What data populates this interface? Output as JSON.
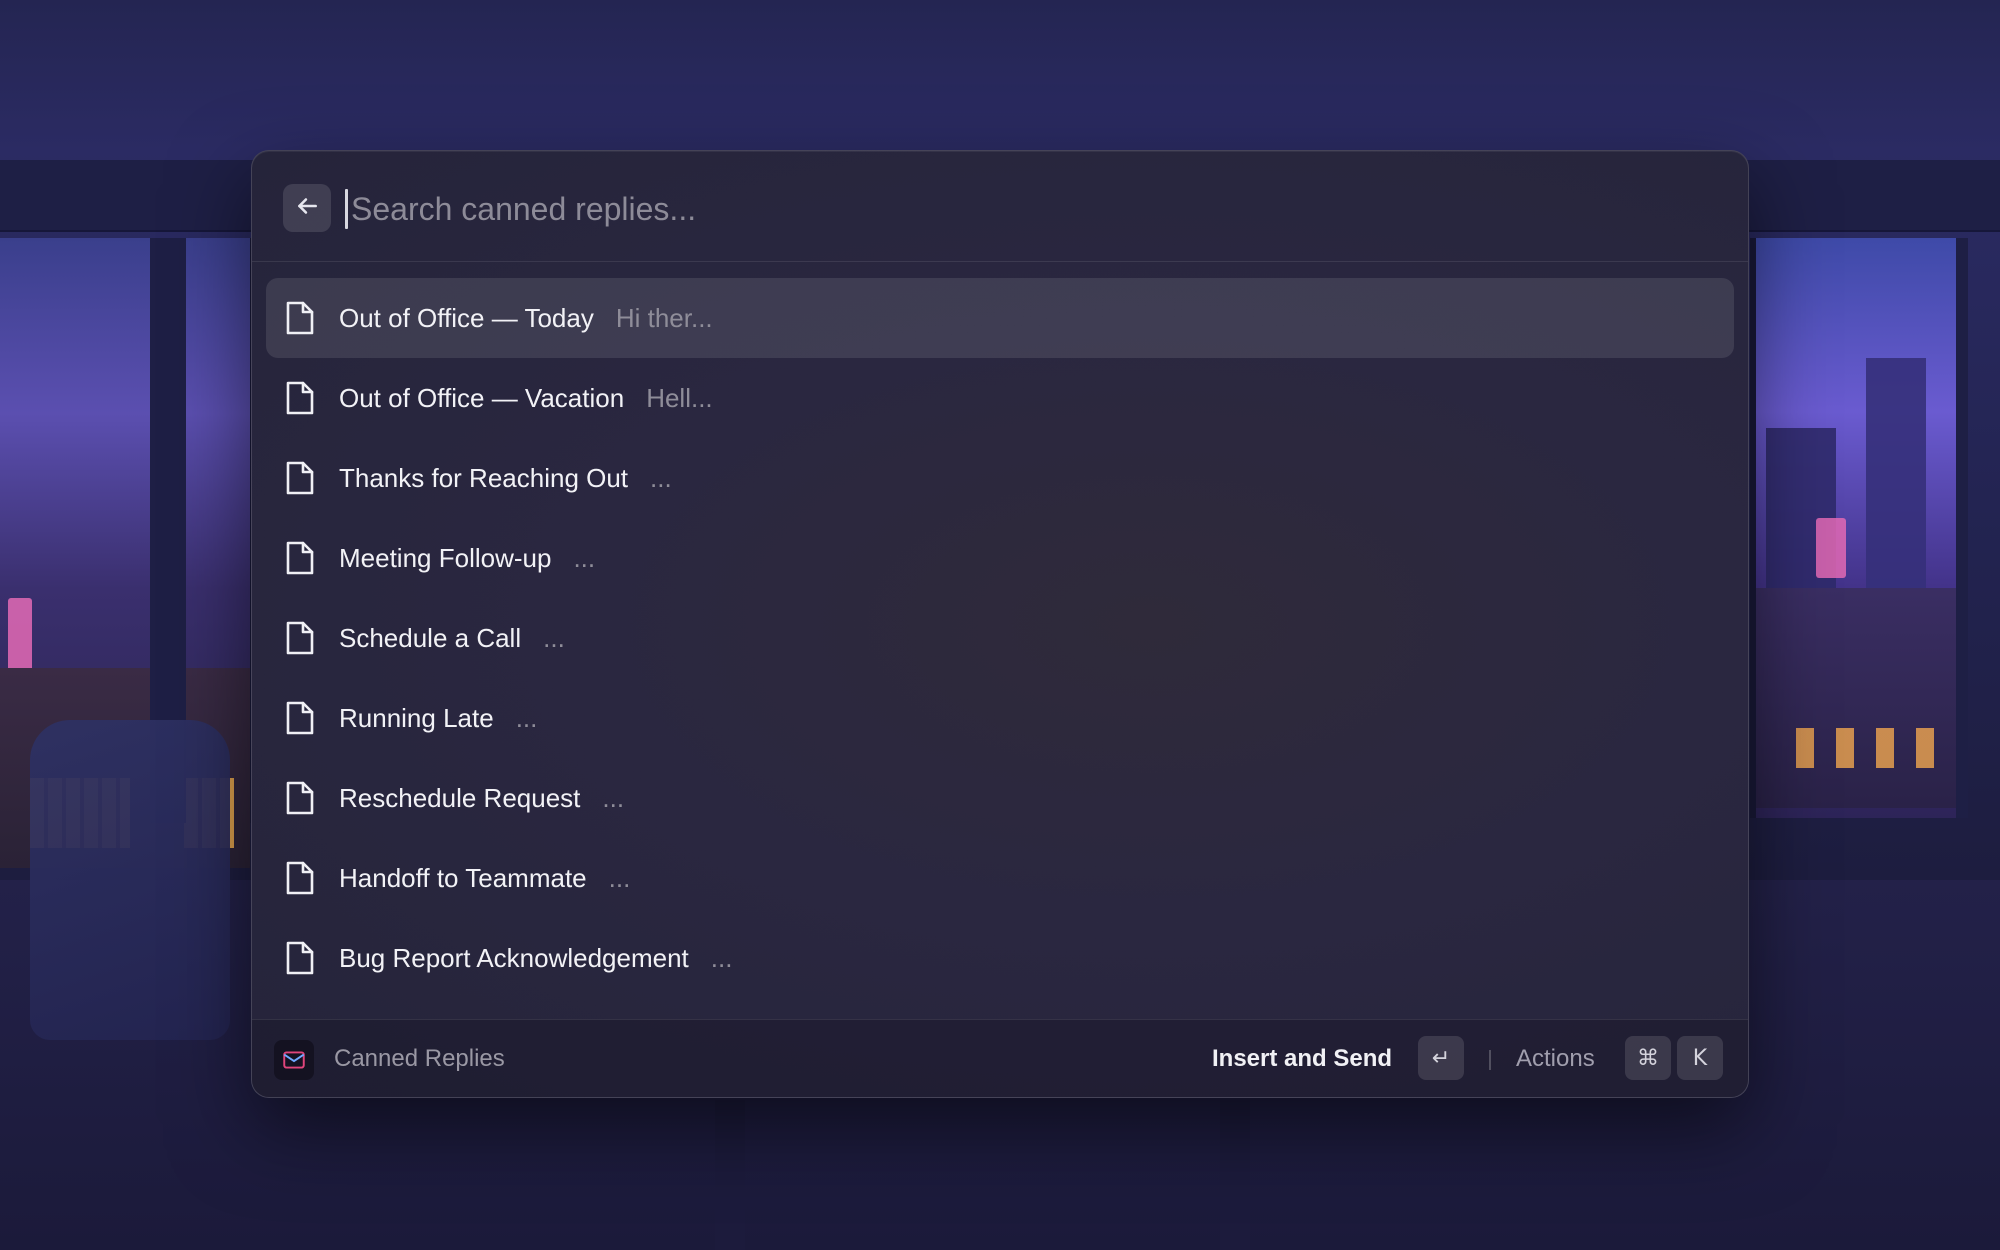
{
  "search": {
    "placeholder": "Search canned replies...",
    "value": ""
  },
  "items": [
    {
      "title": "Out of Office — Today",
      "subtitle": "Hi ther...",
      "selected": true
    },
    {
      "title": "Out of Office — Vacation",
      "subtitle": "Hell...",
      "selected": false
    },
    {
      "title": "Thanks for Reaching Out",
      "subtitle": "...",
      "selected": false
    },
    {
      "title": "Meeting Follow-up",
      "subtitle": "...",
      "selected": false
    },
    {
      "title": "Schedule a Call",
      "subtitle": "...",
      "selected": false
    },
    {
      "title": "Running Late",
      "subtitle": "...",
      "selected": false
    },
    {
      "title": "Reschedule Request",
      "subtitle": "...",
      "selected": false
    },
    {
      "title": "Handoff to Teammate",
      "subtitle": "...",
      "selected": false
    },
    {
      "title": "Bug Report Acknowledgement",
      "subtitle": "...",
      "selected": false
    }
  ],
  "footer": {
    "extension_name": "Canned Replies",
    "extension_icon": "mail-icon",
    "primary_action": "Insert and Send",
    "primary_shortcut": "↵",
    "actions_label": "Actions",
    "actions_shortcut": [
      "⌘",
      "K"
    ]
  },
  "icons": {
    "back": "arrow-left-icon",
    "item": "document-icon"
  },
  "colors": {
    "accent_mail": "#e0457b",
    "selected_row": "rgba(255,255,255,0.10)"
  }
}
